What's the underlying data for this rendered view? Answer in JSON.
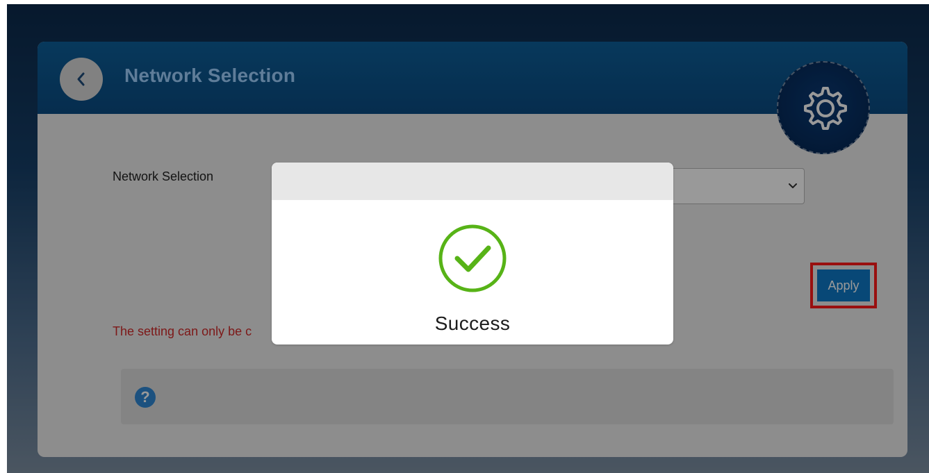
{
  "page": {
    "title": "Network Selection"
  },
  "form": {
    "network_selection_label": "Network Selection",
    "selected_value": "",
    "warning_text": "The setting can only be c"
  },
  "buttons": {
    "apply_label": "Apply"
  },
  "help": {
    "icon_text": "?"
  },
  "modal": {
    "message": "Success"
  },
  "colors": {
    "header": "#0a4b82",
    "title": "#9fd0ff",
    "success": "#57b317",
    "apply": "#0e78c6",
    "warning": "#d02a2a",
    "highlight": "#ff1a1a"
  },
  "icons": {
    "back": "chevron-left-icon",
    "settings": "gear-icon",
    "dropdown": "chevron-down-icon",
    "help": "help-icon",
    "success": "checkmark-circle-icon"
  }
}
